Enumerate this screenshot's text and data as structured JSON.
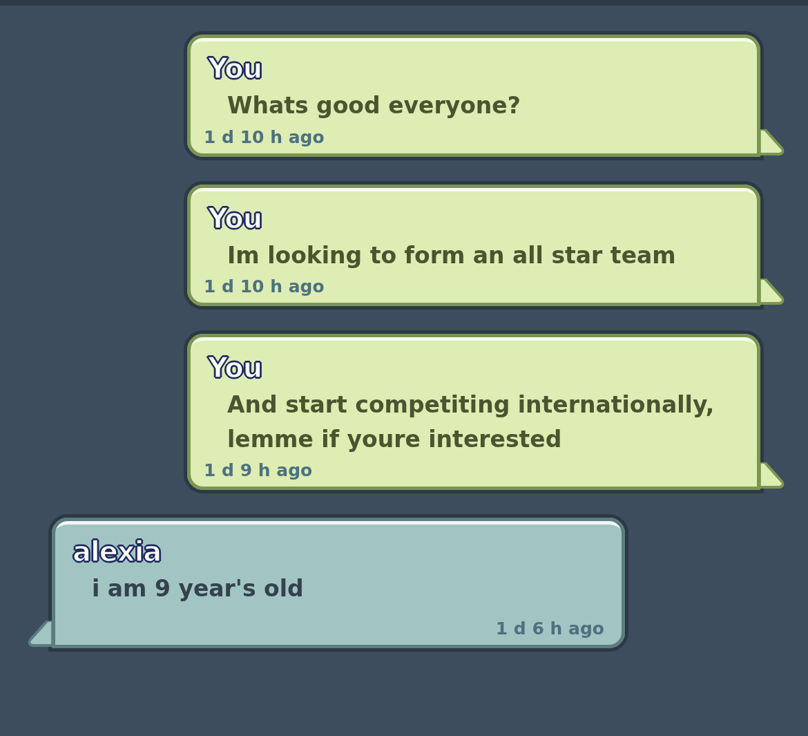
{
  "messages": [
    {
      "kind": "sent",
      "sender": "You",
      "text": "Whats good everyone?",
      "time": "1 d 10 h ago"
    },
    {
      "kind": "sent",
      "sender": "You",
      "text": "Im looking to form an all star team",
      "time": "1 d 10 h ago"
    },
    {
      "kind": "sent",
      "sender": "You",
      "text": "And start competiting internationally, lemme if youre interested",
      "time": "1 d 9 h ago"
    },
    {
      "kind": "received",
      "sender": "alexia",
      "text": "i am 9 year's old",
      "time": "1 d 6 h ago"
    }
  ]
}
